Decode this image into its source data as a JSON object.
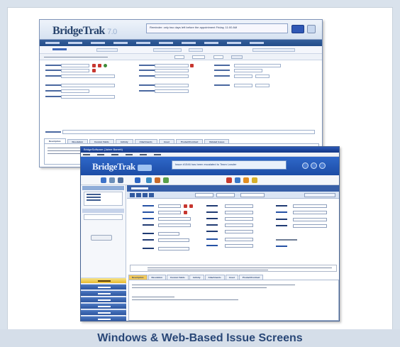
{
  "caption": "Windows & Web-Based Issue Screens",
  "web_window": {
    "logo_text": "BridgeTrak",
    "logo_version": "7.0",
    "message": "Reminder: only two days left before the appointment Friday, 11:00 AM",
    "tabs": [
      "Description",
      "Resolution",
      "Custom Fields",
      "Activity",
      "Attachments",
      "Asset",
      "Product/Contract",
      "Related Issues"
    ]
  },
  "windows_client": {
    "title": "BridgeSoftware (Jaime Barrett)",
    "logo_text": "BridgeTrak",
    "message": "Issue #1546 has been escalated to Team Leader",
    "tabs": [
      "Description",
      "Resolution",
      "Custom Fields",
      "Activity",
      "Attachments",
      "Asset",
      "Product/Contract"
    ],
    "left_nav": [
      "Issues",
      "Team Member",
      "Sources",
      "Setup",
      "Case",
      "Workflow",
      "Reports"
    ]
  },
  "colors": {
    "accent_blue": "#2d5fb8",
    "nav_gold": "#f3c95b",
    "caption_text": "#294777"
  }
}
